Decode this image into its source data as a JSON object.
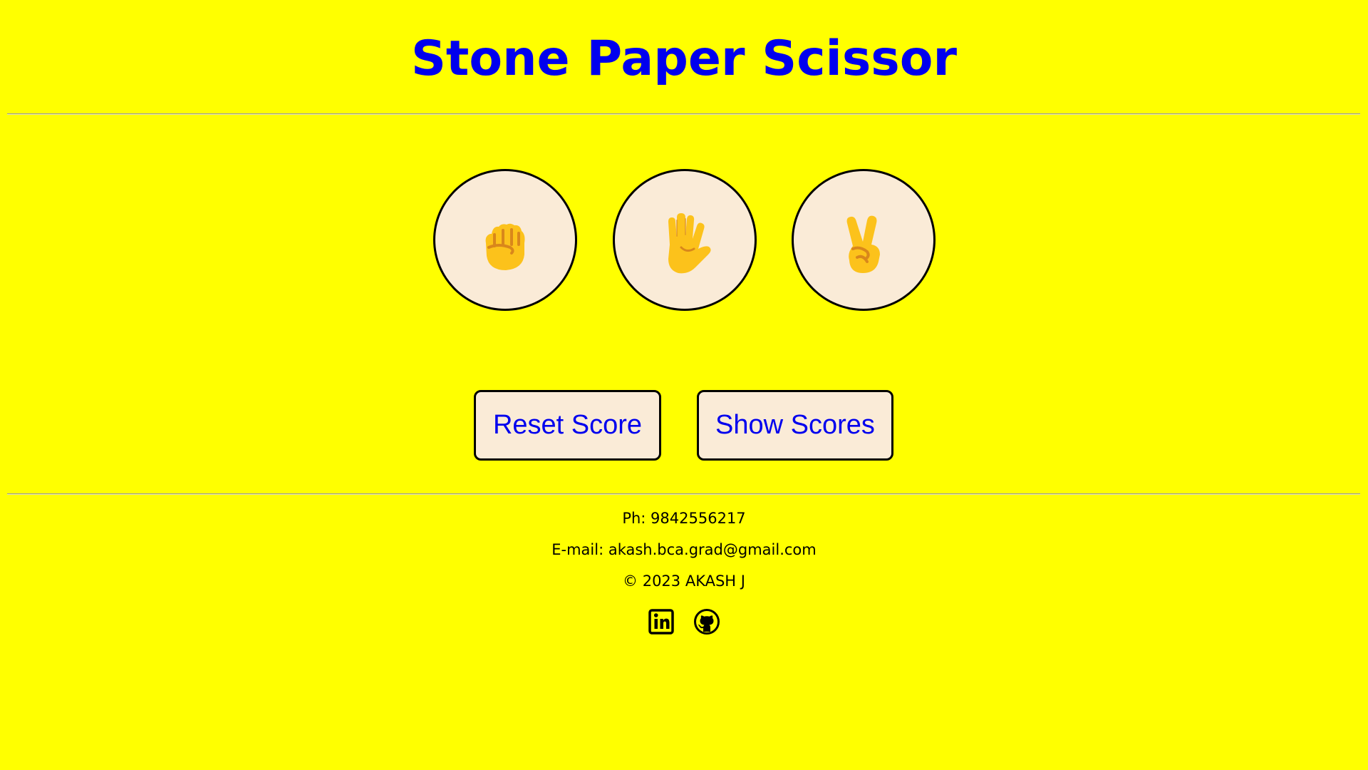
{
  "header": {
    "title": "Stone Paper Scissor"
  },
  "choices": [
    {
      "name": "stone",
      "icon": "raised-fist-icon"
    },
    {
      "name": "paper",
      "icon": "raised-hand-icon"
    },
    {
      "name": "scissor",
      "icon": "victory-hand-icon"
    }
  ],
  "buttons": {
    "reset_label": "Reset Score",
    "show_label": "Show Scores"
  },
  "footer": {
    "phone": "Ph: 9842556217",
    "email": "E-mail: akash.bca.grad@gmail.com",
    "copyright": "© 2023 AKASH J",
    "social": [
      {
        "icon": "linkedin-icon"
      },
      {
        "icon": "github-icon"
      }
    ]
  },
  "colors": {
    "background": "#ffff00",
    "title": "#0000ee",
    "button_text": "#0000ee",
    "choice_fill": "#faebd7",
    "skin": "#fcc21b",
    "skin_shadow": "#d9871b"
  }
}
